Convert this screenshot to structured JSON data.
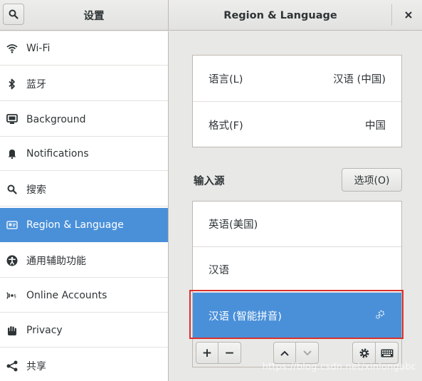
{
  "header": {
    "left_title": "设置",
    "right_title": "Region & Language"
  },
  "sidebar": {
    "items": [
      {
        "label": "Wi-Fi",
        "icon": "wifi-icon"
      },
      {
        "label": "蓝牙",
        "icon": "bluetooth-icon"
      },
      {
        "label": "Background",
        "icon": "background-icon"
      },
      {
        "label": "Notifications",
        "icon": "bell-icon"
      },
      {
        "label": "搜索",
        "icon": "search-icon"
      },
      {
        "label": "Region & Language",
        "icon": "region-icon",
        "active": true
      },
      {
        "label": "通用辅助功能",
        "icon": "accessibility-icon"
      },
      {
        "label": "Online Accounts",
        "icon": "online-accounts-icon"
      },
      {
        "label": "Privacy",
        "icon": "hand-icon"
      },
      {
        "label": "共享",
        "icon": "share-icon"
      }
    ]
  },
  "main": {
    "language_label": "语言(L)",
    "language_value": "汉语 (中国)",
    "format_label": "格式(F)",
    "format_value": "中国",
    "input_sources_title": "输入源",
    "options_button": "选项(O)",
    "input_sources": [
      "英语(美国)",
      "汉语",
      "汉语 (智能拼音)"
    ]
  },
  "toolbar": {
    "add": "+",
    "remove": "−"
  },
  "watermark": "https://blog.csdn.net/xinlongabc",
  "colors": {
    "accent": "#4a90d9",
    "highlight_box": "#d9302c"
  }
}
